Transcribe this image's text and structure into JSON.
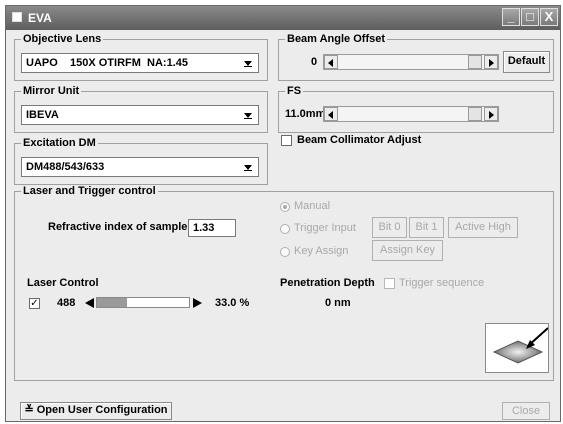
{
  "window": {
    "title": "EVA",
    "controls": [
      "_",
      "□",
      "X"
    ]
  },
  "objective": {
    "legend": "Objective Lens",
    "selected": "UAPO    150X OTIRFM  NA:1.45"
  },
  "mirror": {
    "legend": "Mirror Unit",
    "selected": "IBEVA"
  },
  "excitation": {
    "legend": "Excitation DM",
    "selected": "DM488/543/633"
  },
  "beam_angle": {
    "legend": "Beam Angle Offset",
    "value": "0",
    "default_label": "Default"
  },
  "fs": {
    "legend": "FS",
    "value": "11.0mm"
  },
  "collimator": {
    "label": "Beam Collimator Adjust",
    "checked": false
  },
  "laser_trigger": {
    "legend": "Laser and Trigger control",
    "refractive_label": "Refractive index of sample",
    "refractive_value": "1.33",
    "manual_label": "Manual",
    "trigger_input_label": "Trigger Input",
    "bit0_label": "Bit 0",
    "bit1_label": "Bit 1",
    "active_high_label": "Active High",
    "key_assign_label": "Key Assign",
    "assign_key_label": "Assign Key",
    "laser_control_label": "Laser Control",
    "laser_wavelength": "488",
    "laser_power": "33.0 %",
    "laser_level": 0.33,
    "laser_checked": true,
    "penetration_label": "Penetration Depth",
    "penetration_value": "0 nm",
    "trigger_sequence_label": "Trigger sequence"
  },
  "footer": {
    "open_config_label": "Open User Configuration",
    "close_label": "Close"
  },
  "colors": {
    "titlebar": "#6e6e6e",
    "background": "#ececec",
    "disabled_text": "#a8a8a8"
  }
}
